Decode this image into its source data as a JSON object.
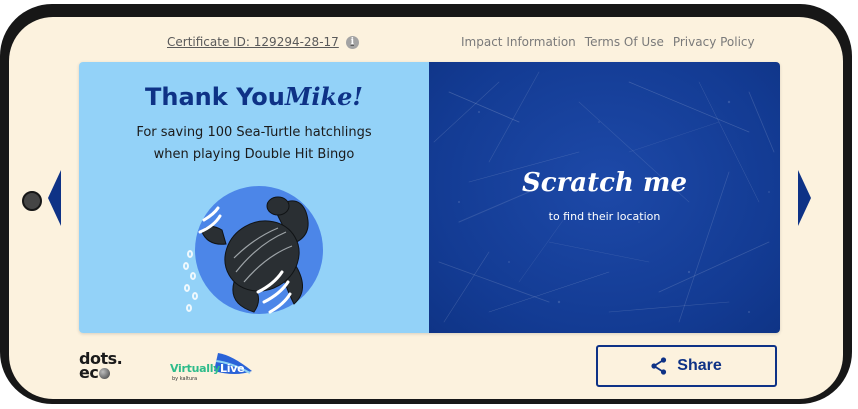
{
  "header": {
    "certificate_label": "Certificate ID: 129294-28-17",
    "links": [
      "Impact Information",
      "Terms Of Use",
      "Privacy Policy"
    ]
  },
  "card": {
    "thank_word": "Thank You",
    "name": "Mike!",
    "subtitle_line1": "For saving 100 Sea-Turtle hatchlings",
    "subtitle_line2": "when playing Double Hit Bingo",
    "scratch_title": "Scratch me",
    "scratch_subtitle": "to find their location"
  },
  "footer": {
    "logo_dots_line1": "dots.",
    "logo_dots_line2": "ec",
    "logo_vl_main": "Virtually",
    "logo_vl_live": "Live",
    "logo_vl_by": "by kaltura",
    "share_label": "Share"
  },
  "icons": {
    "info": "info-icon",
    "share": "share-icon",
    "prev": "chevron-left-icon",
    "next": "chevron-right-icon"
  },
  "colors": {
    "brand_blue": "#0e3286",
    "scratch_blue": "#133b93",
    "light_blue": "#93d2f8",
    "cream": "#fcf2de"
  }
}
